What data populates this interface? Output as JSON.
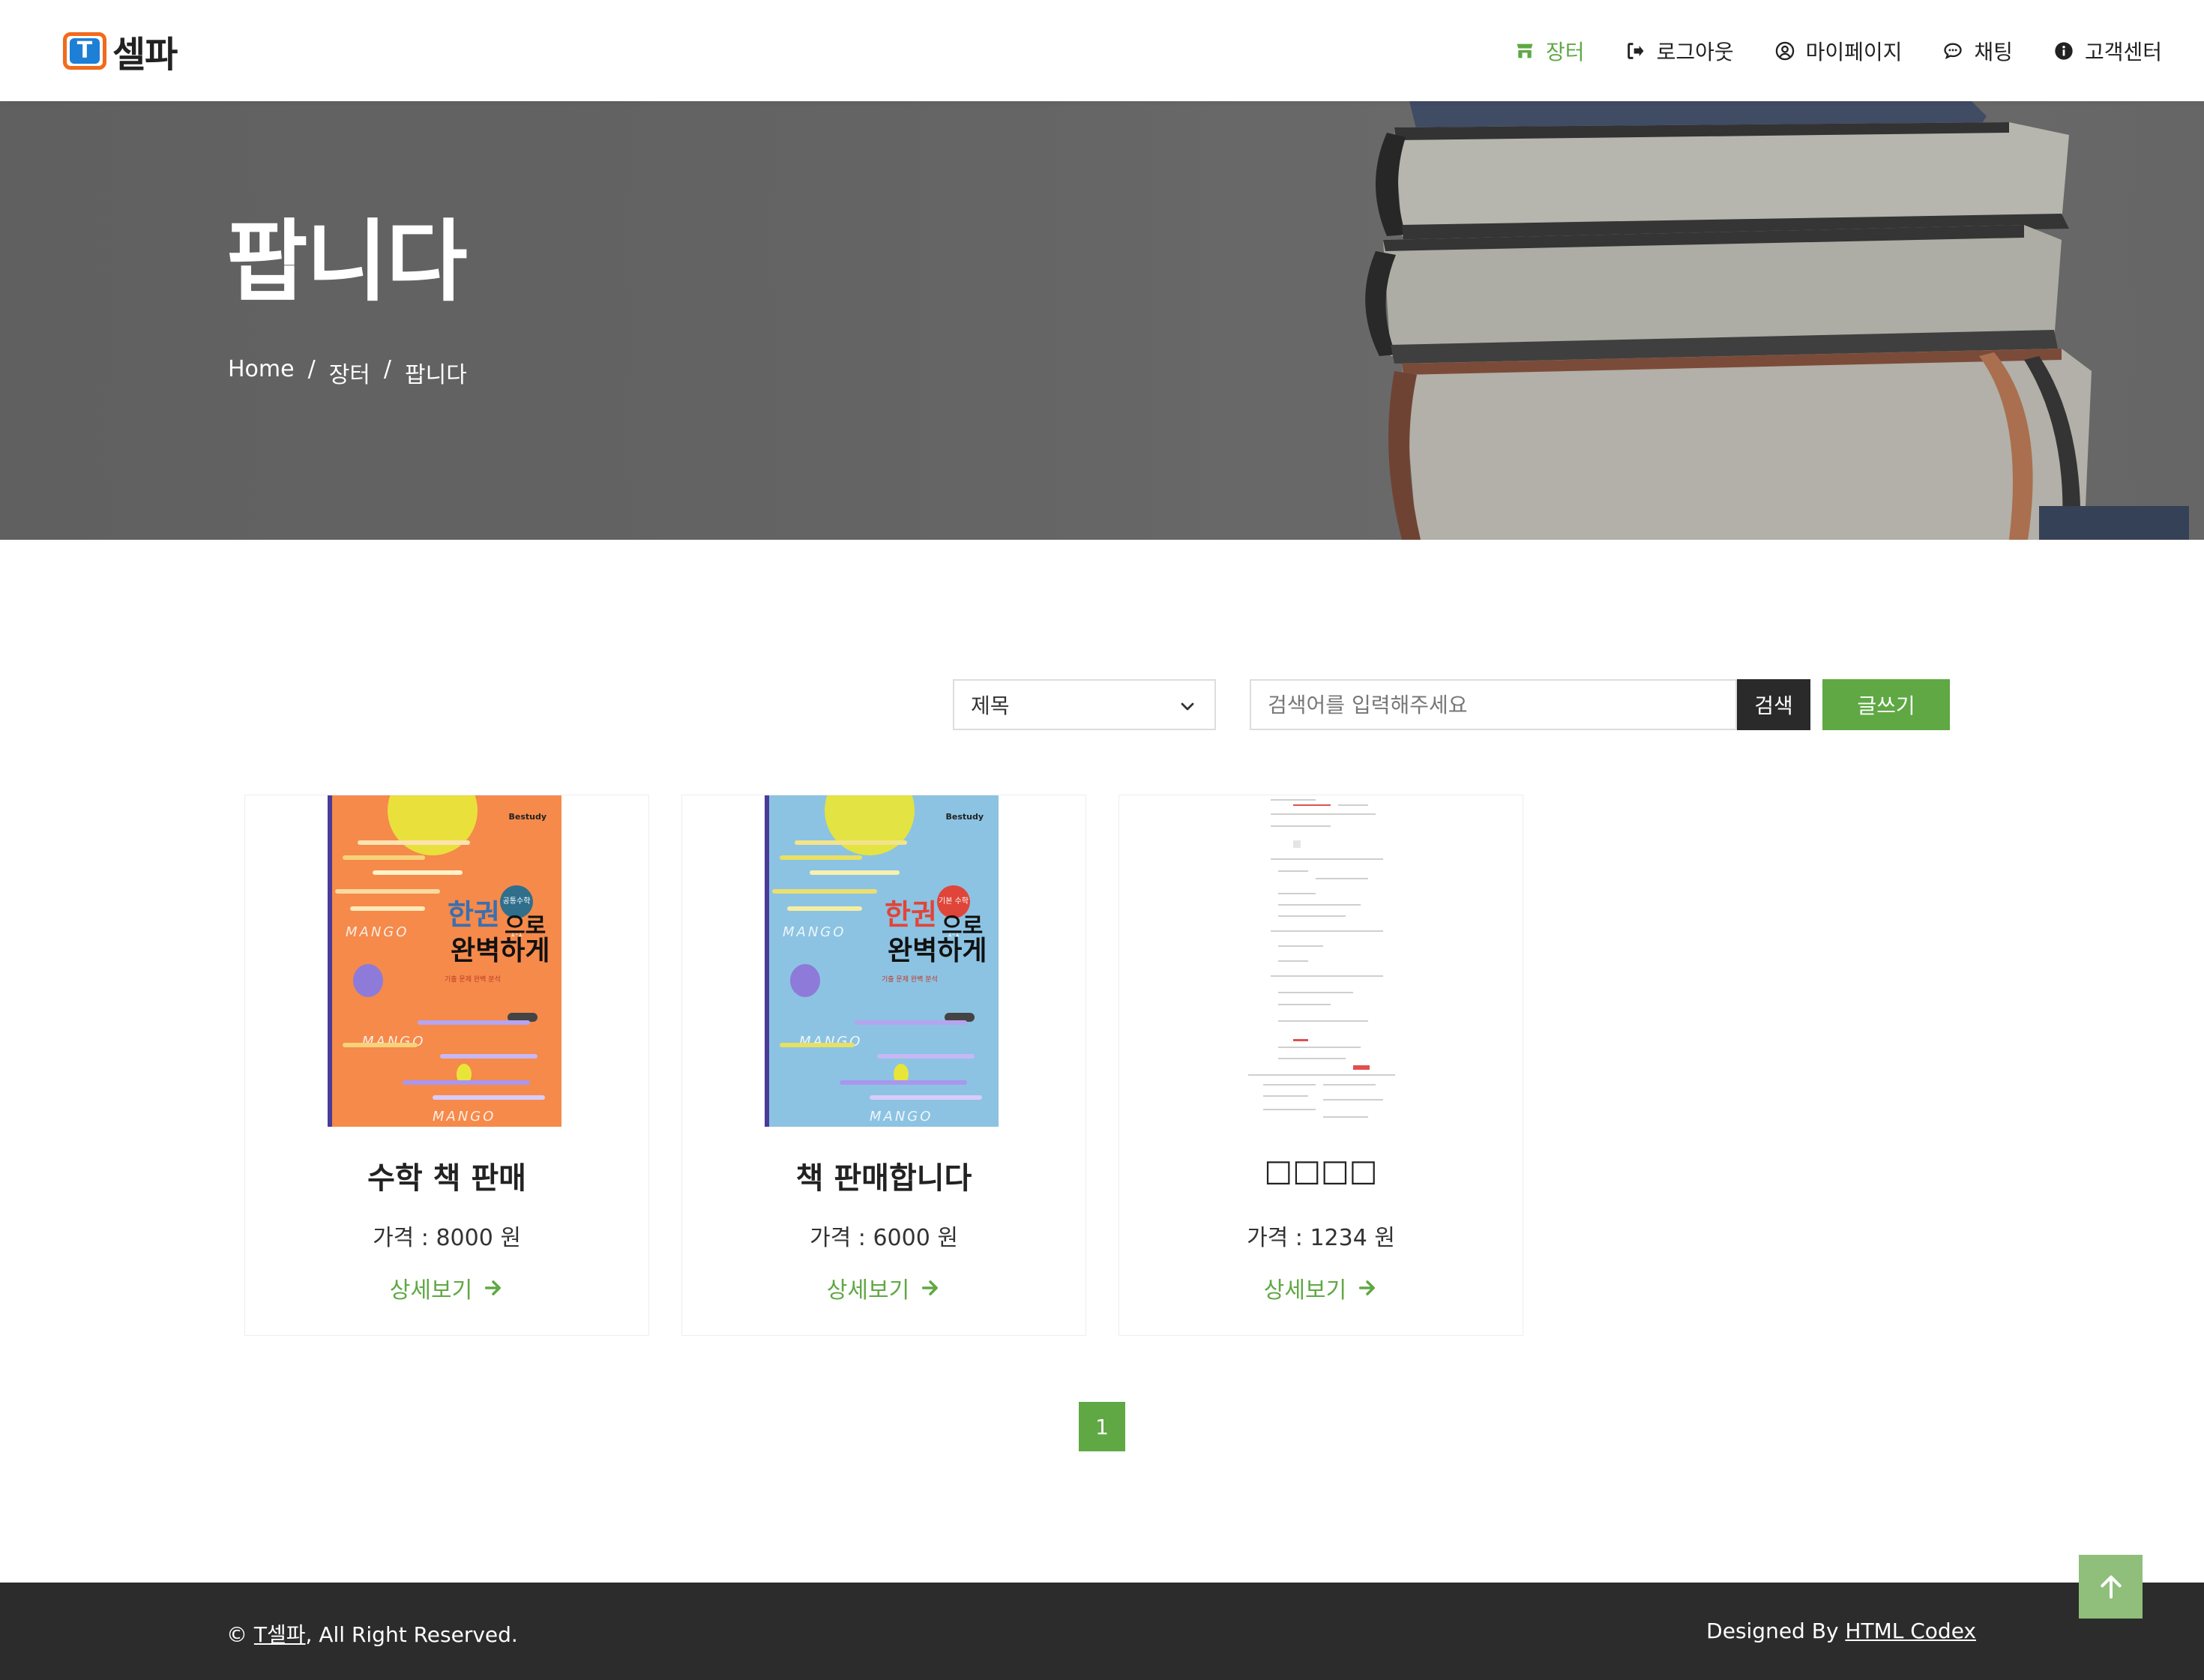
{
  "header": {
    "brand_name": "셀파",
    "brand_logo_letter": "T",
    "nav": [
      {
        "label": "장터",
        "icon": "store-icon",
        "active": true
      },
      {
        "label": "로그아웃",
        "icon": "logout-icon",
        "active": false
      },
      {
        "label": "마이페이지",
        "icon": "user-circle-icon",
        "active": false
      },
      {
        "label": "채팅",
        "icon": "chat-icon",
        "active": false
      },
      {
        "label": "고객센터",
        "icon": "info-icon",
        "active": false
      }
    ]
  },
  "hero": {
    "title": "팝니다",
    "breadcrumb": [
      "Home",
      "장터",
      "팝니다"
    ],
    "separator": "/"
  },
  "search": {
    "select_value": "제목",
    "placeholder": "검색어를 입력해주세요",
    "search_label": "검색",
    "write_label": "글쓰기"
  },
  "products": [
    {
      "title": "수학 책 판매",
      "price": "가격 : 8000 원",
      "link": "상세보기",
      "image": "book-cover-orange"
    },
    {
      "title": "책 판매합니다",
      "price": "가격 : 6000 원",
      "link": "상세보기",
      "image": "book-cover-blue"
    },
    {
      "title": "□□□□",
      "price": "가격 : 1234 원",
      "link": "상세보기",
      "image": "screenshot-thumbnail"
    }
  ],
  "cover_text": {
    "brand": "Bestudy",
    "badge_orange": "공통수학 1-1",
    "badge_blue": "기본 수학 1-1",
    "title_line1": "한권",
    "title_line1b": "으로",
    "title_line2": "완벽하게",
    "subtitle": "기출 문제 완벽 분석",
    "mango": "MANGO"
  },
  "pagination": {
    "pages": [
      "1"
    ],
    "current": "1"
  },
  "footer": {
    "copyright_prefix": "©",
    "copyright_link": "T셀파",
    "copyright_suffix": ", All Right Reserved.",
    "designed_prefix": "Designed By",
    "designed_link": "HTML Codex"
  },
  "colors": {
    "accent": "#5fa844",
    "dark": "#2c2c2c",
    "logo_orange": "#f26a1b",
    "logo_blue": "#1e7fd6",
    "cover_orange": "#f58a4b",
    "cover_blue": "#8cc3e2"
  }
}
